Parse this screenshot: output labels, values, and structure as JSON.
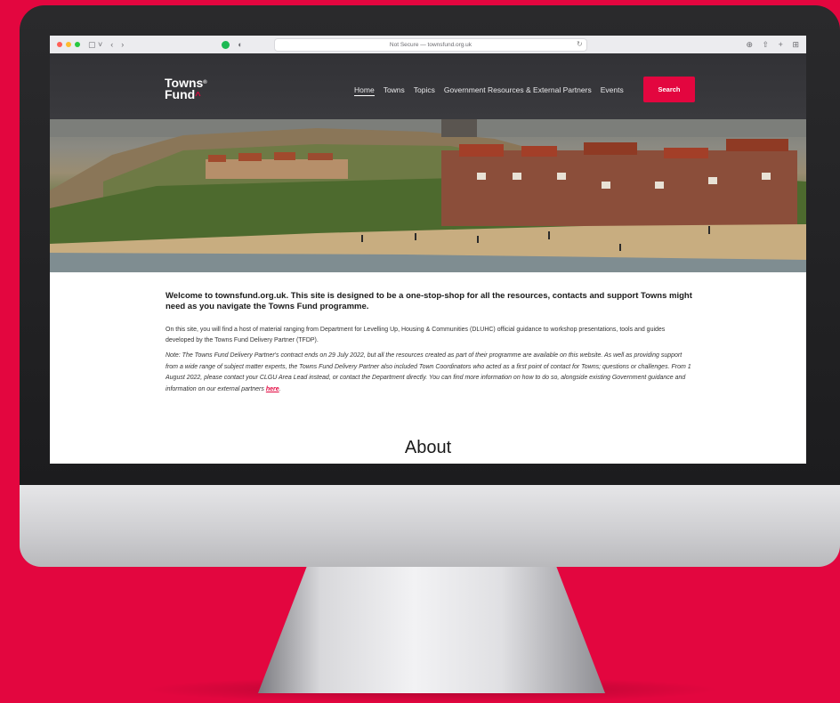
{
  "browser": {
    "url": "Not Secure — townsfund.org.uk"
  },
  "site": {
    "logo_line1": "Towns",
    "logo_line2": "Fund",
    "nav": [
      "Home",
      "Towns",
      "Topics",
      "Government Resources & External Partners",
      "Events"
    ],
    "search_label": "Search"
  },
  "content": {
    "welcome": "Welcome to townsfund.org.uk. This site is designed to be a one-stop-shop for all the resources, contacts and support Towns might need as you navigate the Towns Fund programme.",
    "intro": "On this site, you will find a host of material ranging from Department for Levelling Up, Housing & Communities (DLUHC) official guidance to workshop presentations, tools and guides developed by the Towns Fund Delivery Partner (TFDP).",
    "note": "Note: The Towns Fund Delivery Partner's contract ends on 29 July 2022, but all the resources created as part of their programme are available on this website. As well as providing support from a wide range of subject matter experts, the Towns Fund Delivery Partner also included Town Coordinators who acted as a first point of contact for Towns; questions or challenges. From 1 August 2022, please contact your CLGU Area Lead instead, or contact the Department directly. You can find more information on how to do so, alongside existing Government guidance and information on our external partners ",
    "note_link": "here",
    "note_end": ".",
    "about_heading": "About"
  },
  "colors": {
    "brand": "#e3063f",
    "header_bg": "#323236"
  }
}
